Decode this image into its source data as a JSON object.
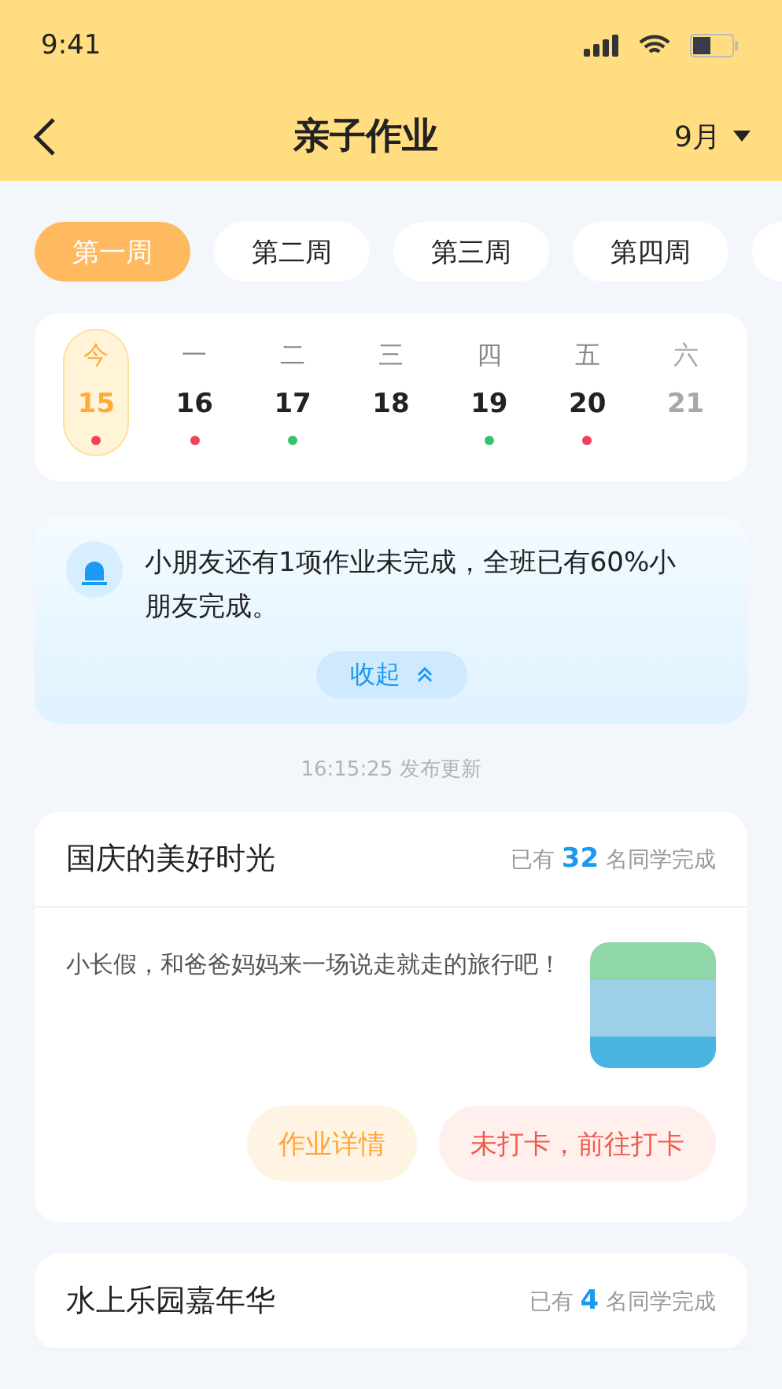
{
  "status_bar": {
    "time": "9:41"
  },
  "nav": {
    "title": "亲子作业",
    "month": "9月"
  },
  "weeks": [
    {
      "label": "第一周",
      "selected": true
    },
    {
      "label": "第二周",
      "selected": false
    },
    {
      "label": "第三周",
      "selected": false
    },
    {
      "label": "第四周",
      "selected": false
    }
  ],
  "days": [
    {
      "weekday": "今",
      "date": "15",
      "selected": true,
      "disabled": false,
      "color": "#f2405a"
    },
    {
      "weekday": "一",
      "date": "16",
      "selected": false,
      "disabled": false,
      "color": "#f2405a"
    },
    {
      "weekday": "二",
      "date": "17",
      "selected": false,
      "disabled": false,
      "color": "#35c46a"
    },
    {
      "weekday": "三",
      "date": "18",
      "selected": false,
      "disabled": false
    },
    {
      "weekday": "四",
      "date": "19",
      "selected": false,
      "disabled": false,
      "color": "#35c46a"
    },
    {
      "weekday": "五",
      "date": "20",
      "selected": false,
      "disabled": false,
      "color": "#f2405a"
    },
    {
      "weekday": "六",
      "date": "21",
      "selected": false,
      "disabled": true
    }
  ],
  "notice": {
    "text": "小朋友还有1项作业未完成，全班已有60%小朋友完成。",
    "collapse": "收起",
    "expanded": true
  },
  "updated": "16:15:25  发布更新",
  "tasks": [
    {
      "title": "国庆的美好时光",
      "completed": "已有 **32** 名同学完成",
      "description": "小长假，和爸爸妈妈来一场说走就走的旅行吧！",
      "buttons": [
        "作业详情",
        "未打卡，前往打卡"
      ]
    },
    {
      "title": "水上乐园嘉年华",
      "completed": "已有 **4** 名同学完成"
    }
  ]
}
